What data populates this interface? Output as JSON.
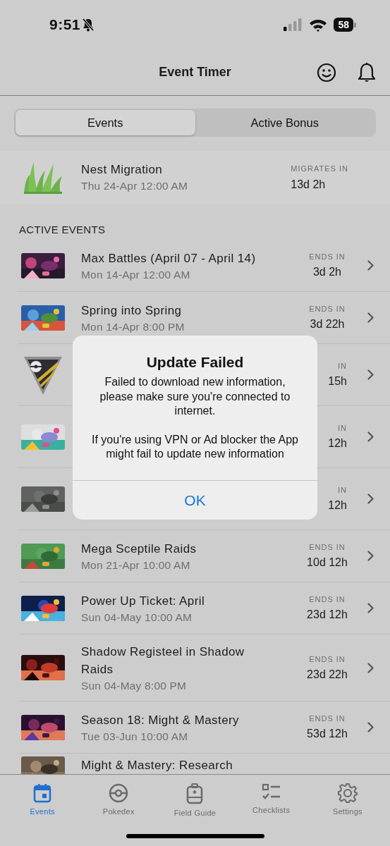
{
  "status_bar": {
    "time": "9:51",
    "battery": "58"
  },
  "header": {
    "title": "Event Timer"
  },
  "segments": [
    {
      "label": "Events",
      "selected": true
    },
    {
      "label": "Active Bonus",
      "selected": false
    }
  ],
  "nest": {
    "title": "Nest Migration",
    "date": "Thu 24-Apr 12:00 AM",
    "countdown_label": "MIGRATES IN",
    "countdown": "13d 2h"
  },
  "section_title": "ACTIVE EVENTS",
  "events": [
    {
      "kind": "full",
      "title": "Max Battles (April 07 - April 14)",
      "date": "Mon 14-Apr 12:00 AM",
      "countdown_label": "ENDS IN",
      "countdown": "3d 2h"
    },
    {
      "kind": "full",
      "title": "Spring into Spring",
      "date": "Mon 14-Apr 8:00 PM",
      "countdown_label": "ENDS IN",
      "countdown": "3d 22h"
    },
    {
      "kind": "badge",
      "countdown_label": "IN",
      "countdown": "15h"
    },
    {
      "kind": "partial",
      "countdown_label": "IN",
      "countdown": "12h"
    },
    {
      "kind": "partial",
      "countdown_label": "IN",
      "countdown": "12h"
    },
    {
      "kind": "full",
      "title": "Mega Sceptile Raids",
      "date": "Mon 21-Apr 10:00 AM",
      "countdown_label": "ENDS IN",
      "countdown": "10d 12h"
    },
    {
      "kind": "full",
      "title": "Power Up Ticket: April",
      "date": "Sun 04-May 10:00 AM",
      "countdown_label": "ENDS IN",
      "countdown": "23d 12h"
    },
    {
      "kind": "full",
      "title": "Shadow Registeel in Shadow Raids",
      "date": "Sun 04-May 8:00 PM",
      "countdown_label": "ENDS IN",
      "countdown": "23d 22h"
    },
    {
      "kind": "full",
      "title": "Season 18: Might & Mastery",
      "date": "Tue 03-Jun 10:00 AM",
      "countdown_label": "ENDS IN",
      "countdown": "53d 12h"
    },
    {
      "kind": "cut",
      "title": "Might & Mastery: Research"
    }
  ],
  "alert": {
    "title": "Update Failed",
    "message": "Failed to download new information, please make sure you're connected to internet.",
    "note": "If you're using VPN or Ad blocker the App might fail to update new information",
    "button": "OK"
  },
  "tabs": [
    {
      "label": "Events",
      "selected": true
    },
    {
      "label": "Pokedex",
      "selected": false
    },
    {
      "label": "Field Guide",
      "selected": false
    },
    {
      "label": "Checklists",
      "selected": false
    },
    {
      "label": "Settings",
      "selected": false
    }
  ]
}
